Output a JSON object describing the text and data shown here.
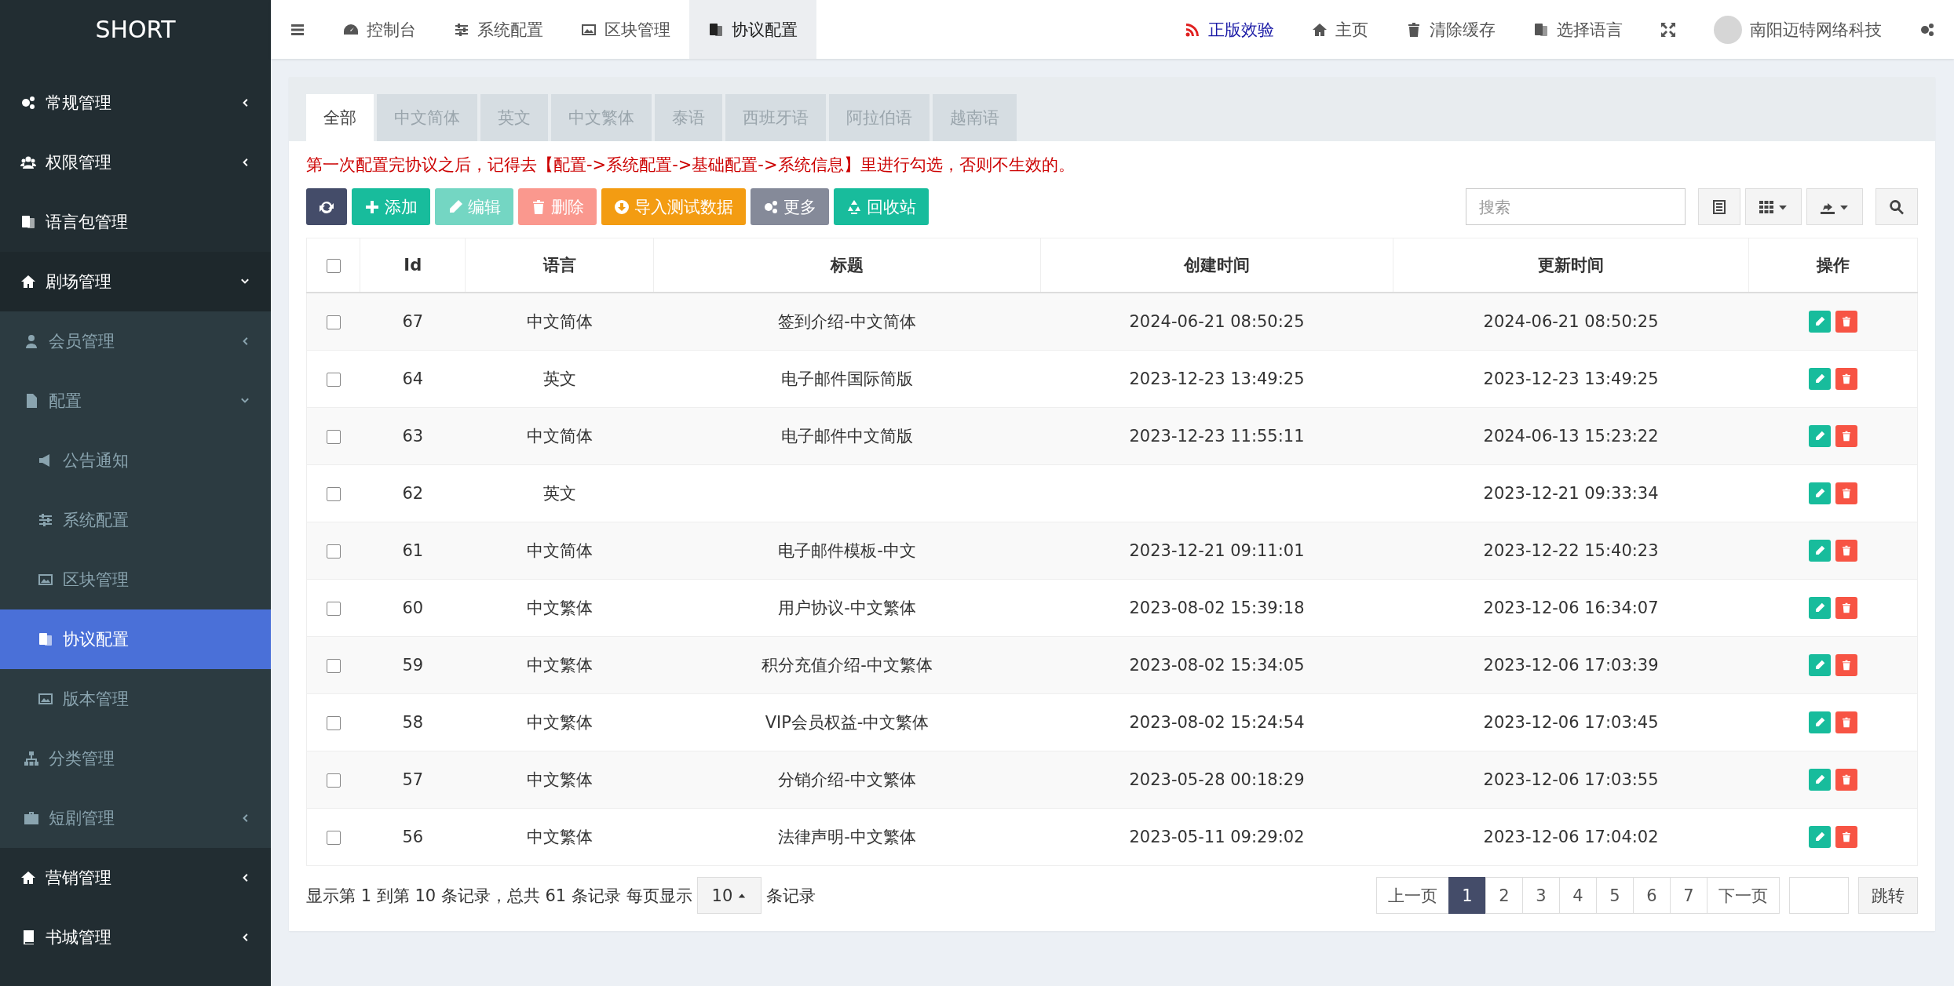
{
  "sidebar": {
    "logo": "SHORT",
    "items": [
      {
        "label": "常规管理",
        "selected": false,
        "expanded": false
      },
      {
        "label": "权限管理",
        "selected": false,
        "expanded": false
      },
      {
        "label": "语言包管理",
        "selected": false
      },
      {
        "label": "剧场管理",
        "selected": false,
        "expanded": true,
        "children": [
          {
            "label": "会员管理",
            "selected": false,
            "expanded": false
          },
          {
            "label": "配置",
            "selected": false,
            "expanded": true,
            "children": [
              {
                "label": "公告通知",
                "selected": false
              },
              {
                "label": "系统配置",
                "selected": false
              },
              {
                "label": "区块管理",
                "selected": false
              },
              {
                "label": "协议配置",
                "selected": true
              },
              {
                "label": "版本管理",
                "selected": false
              }
            ]
          },
          {
            "label": "分类管理",
            "selected": false
          },
          {
            "label": "短剧管理",
            "selected": false,
            "expanded": false
          }
        ]
      },
      {
        "label": "营销管理",
        "selected": false,
        "expanded": false
      },
      {
        "label": "书城管理",
        "selected": false,
        "expanded": false
      }
    ]
  },
  "header": {
    "nav_tabs": [
      {
        "label": "控制台",
        "selected": false
      },
      {
        "label": "系统配置",
        "selected": false
      },
      {
        "label": "区块管理",
        "selected": false
      },
      {
        "label": "协议配置",
        "selected": true
      }
    ],
    "links": [
      {
        "label": "正版效验",
        "kind": "highlight"
      },
      {
        "label": "主页",
        "kind": "plain"
      },
      {
        "label": "清除缓存",
        "kind": "plain"
      },
      {
        "label": "选择语言",
        "kind": "plain"
      }
    ],
    "user_name": "南阳迈特网络科技"
  },
  "language_tabs": [
    {
      "label": "全部",
      "selected": true
    },
    {
      "label": "中文简体",
      "selected": false
    },
    {
      "label": "英文",
      "selected": false
    },
    {
      "label": "中文繁体",
      "selected": false
    },
    {
      "label": "泰语",
      "selected": false
    },
    {
      "label": "西班牙语",
      "selected": false
    },
    {
      "label": "阿拉伯语",
      "selected": false
    },
    {
      "label": "越南语",
      "selected": false
    }
  ],
  "notice": "第一次配置完协议之后，记得去【配置->系统配置->基础配置->系统信息】里进行勾选，否则不生效的。",
  "toolbar": [
    {
      "kind": "dark",
      "disabled": false
    },
    {
      "kind": "success",
      "label": "添加",
      "disabled": false
    },
    {
      "kind": "success",
      "label": "编辑",
      "disabled": true
    },
    {
      "kind": "danger",
      "label": "删除",
      "disabled": true
    },
    {
      "kind": "warning",
      "label": "导入测试数据",
      "disabled": false
    },
    {
      "kind": "grey",
      "label": "更多",
      "disabled": false
    },
    {
      "kind": "success",
      "label": "回收站",
      "disabled": false
    }
  ],
  "search": {
    "placeholder": "搜索"
  },
  "table": {
    "select_all_checked": false,
    "columns": [
      "Id",
      "语言",
      "标题",
      "创建时间",
      "更新时间",
      "操作"
    ],
    "rows": [
      {
        "checked": false,
        "id": "67",
        "language": "中文简体",
        "title": "签到介绍-中文简体",
        "created": "2024-06-21 08:50:25",
        "updated": "2024-06-21 08:50:25"
      },
      {
        "checked": false,
        "id": "64",
        "language": "英文",
        "title": "电子邮件国际简版",
        "created": "2023-12-23 13:49:25",
        "updated": "2023-12-23 13:49:25"
      },
      {
        "checked": false,
        "id": "63",
        "language": "中文简体",
        "title": "电子邮件中文简版",
        "created": "2023-12-23 11:55:11",
        "updated": "2024-06-13 15:23:22"
      },
      {
        "checked": false,
        "id": "62",
        "language": "英文",
        "updated": "2023-12-21 09:33:34"
      },
      {
        "checked": false,
        "id": "61",
        "language": "中文简体",
        "title": "电子邮件模板-中文",
        "created": "2023-12-21 09:11:01",
        "updated": "2023-12-22 15:40:23"
      },
      {
        "checked": false,
        "id": "60",
        "language": "中文繁体",
        "title": "用户协议-中文繁体",
        "created": "2023-08-02 15:39:18",
        "updated": "2023-12-06 16:34:07"
      },
      {
        "checked": false,
        "id": "59",
        "language": "中文繁体",
        "title": "积分充值介绍-中文繁体",
        "created": "2023-08-02 15:34:05",
        "updated": "2023-12-06 17:03:39"
      },
      {
        "checked": false,
        "id": "58",
        "language": "中文繁体",
        "title": "VIP会员权益-中文繁体",
        "created": "2023-08-02 15:24:54",
        "updated": "2023-12-06 17:03:45"
      },
      {
        "checked": false,
        "id": "57",
        "language": "中文繁体",
        "title": "分销介绍-中文繁体",
        "created": "2023-05-28 00:18:29",
        "updated": "2023-12-06 17:03:55"
      },
      {
        "checked": false,
        "id": "56",
        "language": "中文繁体",
        "title": "法律声明-中文繁体",
        "created": "2023-05-11 09:29:02",
        "updated": "2023-12-06 17:04:02"
      }
    ]
  },
  "footer": {
    "summary": "显示第 1 到第 10 条记录，总共 61 条记录 每页显示",
    "page_size": "10",
    "page_size_suffix": "条记录",
    "prev": "上一页",
    "pages": [
      {
        "label": "1",
        "selected": true
      },
      {
        "label": "2",
        "selected": false
      },
      {
        "label": "3",
        "selected": false
      },
      {
        "label": "4",
        "selected": false
      },
      {
        "label": "5",
        "selected": false
      },
      {
        "label": "6",
        "selected": false
      },
      {
        "label": "7",
        "selected": false
      }
    ],
    "next": "下一页",
    "jump": "跳转"
  }
}
